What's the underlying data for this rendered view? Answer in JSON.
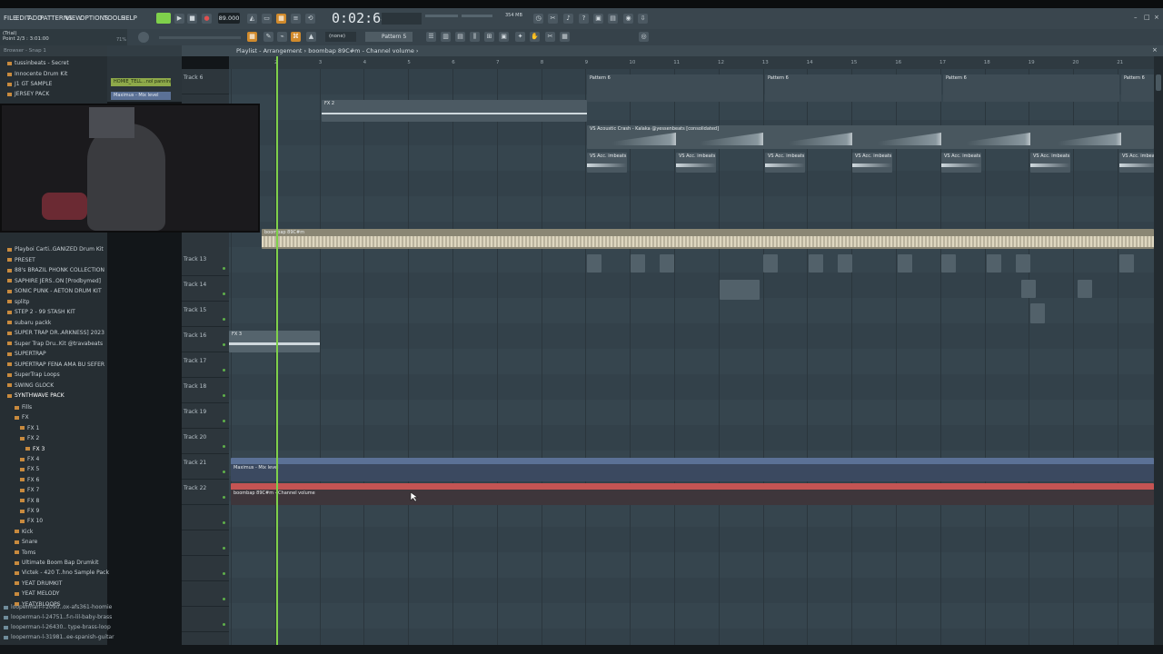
{
  "menu": {
    "items": [
      "FILE",
      "EDIT",
      "ADD",
      "PATTERNS",
      "VIEW",
      "OPTIONS",
      "TOOLS",
      "HELP"
    ]
  },
  "transport": {
    "tempo": "89.000",
    "time": "0:02:64",
    "time_label": "M:S:CS",
    "mem": "354 MB"
  },
  "hint": {
    "line1": "(Trial)",
    "line2": "Point 2/3 : 3:01:00",
    "zoom": "71%"
  },
  "toolbar2": {
    "snap": "(none)",
    "pattern": "Pattern 5"
  },
  "playlist": {
    "title": "Playlist - Arrangement › boombap 89C#m - Channel volume ›",
    "first_track": "Track 6"
  },
  "browser": {
    "header": "Browser - Snap 1",
    "items_top": [
      "tussinbeats - Secret",
      "Innocente Drum Kit",
      "J1 GT SAMPLE",
      "JERSEY PACK"
    ],
    "items": [
      "Playboi Carti..GANIZED Drum Kit",
      "PRESET",
      "88's BRAZIL PHONK COLLECTION",
      "SAPHIRE JERS..ON [Prodbymed]",
      "SONIC PUNK - AETON DRUM KIT",
      "splitp",
      "STEP 2 - 99 STASH KIT",
      "subaru packk",
      "SUPER TRAP DR..ARKNESS] 2023",
      "Super Trap Dru..Kit @travabeats",
      "SUPERTRAP",
      "SUPERTRAP FENA AMA BU SEFER",
      "SuperTrap Loops",
      "SWING GLOCK",
      "SYNTHWAVE PACK"
    ],
    "sub": [
      "Fills",
      "FX",
      "FX 1",
      "FX 2",
      "FX 3",
      "FX 4",
      "FX 5",
      "FX 6",
      "FX 7",
      "FX 8",
      "FX 9",
      "FX 10",
      "Kick",
      "Snare",
      "Toms",
      "Ultimate Boom Bap Drumkit",
      "Victek - 420 T..hno Sample Pack",
      "YEAT DRUMKIT",
      "YEAT MELODY",
      "YEATYBLOOPS"
    ],
    "files": [
      "looperman-l-2090..ox-afs361-hoomie",
      "looperman-l-24751..f-n-lil-baby-brass",
      "looperman-l-26430.. type-brass-loop",
      "looperman-l-31981..ee-spanish-guitar"
    ]
  },
  "channels": {
    "a": "HOMIE_TELL...nol panning",
    "b": "Maximus - Mix level"
  },
  "tracks": [
    "Track 13",
    "Track 14",
    "Track 15",
    "Track 16",
    "Track 17",
    "Track 18",
    "Track 19",
    "Track 20",
    "Track 21",
    "Track 22"
  ],
  "ruler": [
    "2",
    "3",
    "4",
    "5",
    "6",
    "7",
    "8",
    "9",
    "10",
    "11",
    "12",
    "13",
    "14",
    "15",
    "16",
    "17",
    "18",
    "19",
    "20",
    "21"
  ],
  "clips": {
    "pattern": "Pattern 6",
    "fx": "FX 2",
    "crash": "VS Acoustic Crash - Kalaka @yessenbeats [consolidated]",
    "acc": "VS Acc. imbeats",
    "boombap": "boombap 89C#m",
    "maximus": "Maximus - Mix level",
    "chvol": "boombap 89C#m - Channel volume",
    "fx16": "FX 3"
  },
  "colors": {
    "accent": "#7fd04b",
    "maximus": "#5b7196",
    "chvol": "#c45453",
    "audio": "#4e5e68"
  }
}
